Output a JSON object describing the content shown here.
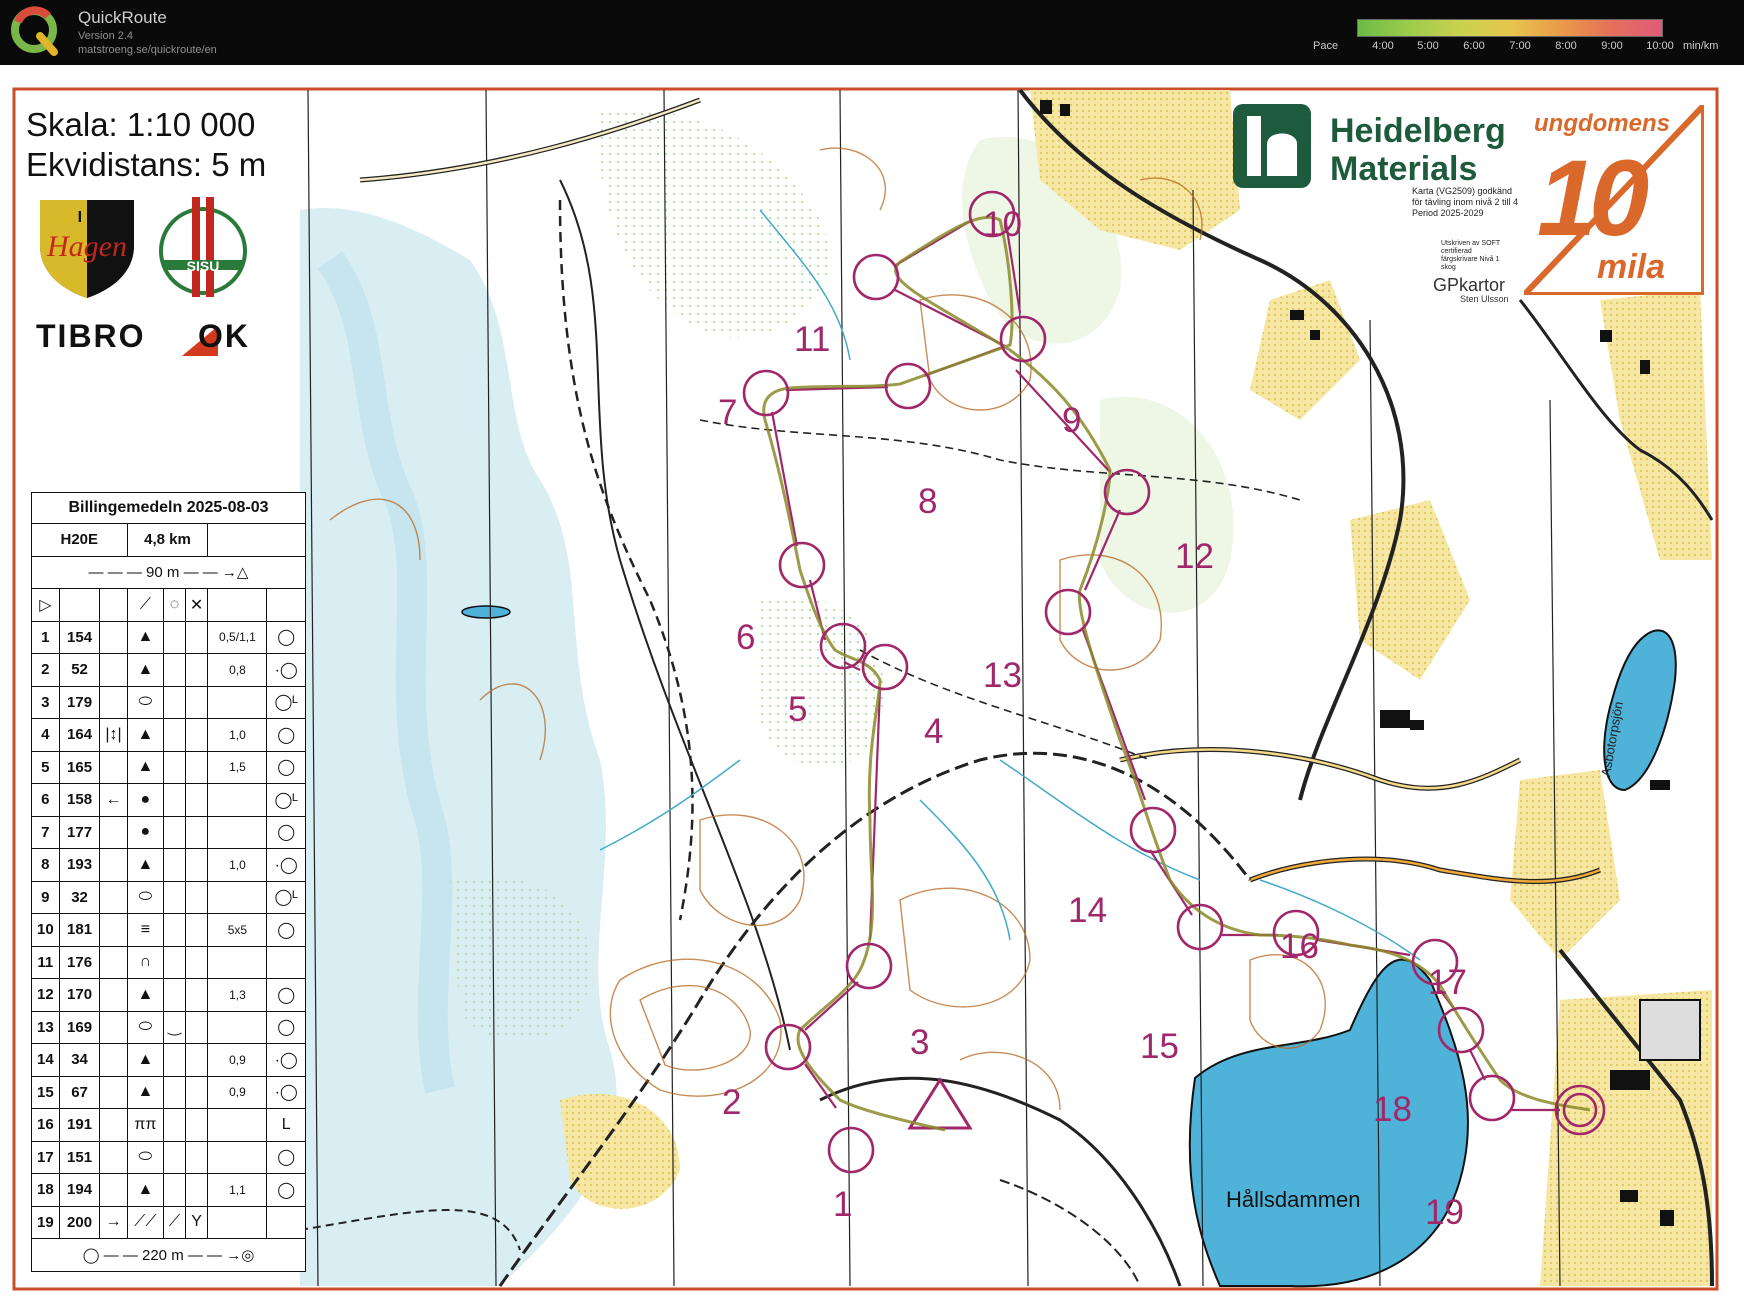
{
  "app": {
    "name": "QuickRoute",
    "version": "Version 2.4",
    "url": "matstroeng.se/quickroute/en"
  },
  "pace_scale": {
    "label": "Pace",
    "ticks": [
      "4:00",
      "5:00",
      "6:00",
      "7:00",
      "8:00",
      "9:00",
      "10:00"
    ],
    "unit": "min/km",
    "colors": [
      "#6dbb45",
      "#9ccb4c",
      "#c8d24f",
      "#e6c64d",
      "#e99a4a",
      "#e5705a",
      "#e05a7a"
    ]
  },
  "map": {
    "scale": "Skala: 1:10 000",
    "contour_interval": "Ekvidistans: 5 m",
    "club_logo_text": "I F Hagen",
    "club_logo2_text": "SISU",
    "tibro_left": "TIBRO",
    "tibro_right": "OK",
    "sponsor": "Heidelberg Materials",
    "certification": "Karta (VG2509) godkänd för tävling inom nivå 2 till 4 Period 2025-2029",
    "certification2": "Utskriven av SOFT certifierad färgskrivare Nivå 1 skog",
    "mapper": "GPkartor",
    "mapper_sub": "Sten Ulsson",
    "ten_mila_top": "ungdomens",
    "ten_mila_num": "10",
    "ten_mila_bottom": "mila",
    "lake_name": "Hållsdammen",
    "lake2_name": "Asbotorpsjön",
    "route_color": "#8a8a2a",
    "course_color": "#a0286a"
  },
  "controls": [
    {
      "n": "1"
    },
    {
      "n": "2"
    },
    {
      "n": "3"
    },
    {
      "n": "4"
    },
    {
      "n": "5"
    },
    {
      "n": "6"
    },
    {
      "n": "7"
    },
    {
      "n": "8"
    },
    {
      "n": "9"
    },
    {
      "n": "10"
    },
    {
      "n": "11"
    },
    {
      "n": "12"
    },
    {
      "n": "13"
    },
    {
      "n": "14"
    },
    {
      "n": "15"
    },
    {
      "n": "16"
    },
    {
      "n": "17"
    },
    {
      "n": "18"
    },
    {
      "n": "19"
    }
  ],
  "description": {
    "event": "Billingemedeln 2025-08-03",
    "class": "H20E",
    "length": "4,8 km",
    "start_marked": "90 m",
    "finish_marked": "220 m",
    "rows": [
      {
        "num": "1",
        "code": "154",
        "c": "",
        "d": "▲",
        "e": "",
        "f": "",
        "g": "0,5/1,1",
        "h": "◯"
      },
      {
        "num": "2",
        "code": "52",
        "c": "",
        "d": "▲",
        "e": "",
        "f": "",
        "g": "0,8",
        "h": "·◯"
      },
      {
        "num": "3",
        "code": "179",
        "c": "",
        "d": "⬭",
        "e": "",
        "f": "",
        "g": "",
        "h": "◯ᴸ"
      },
      {
        "num": "4",
        "code": "164",
        "c": "|↕|",
        "d": "▲",
        "e": "",
        "f": "",
        "g": "1,0",
        "h": "◯"
      },
      {
        "num": "5",
        "code": "165",
        "c": "",
        "d": "▲",
        "e": "",
        "f": "",
        "g": "1,5",
        "h": "◯"
      },
      {
        "num": "6",
        "code": "158",
        "c": "←",
        "d": "●",
        "e": "",
        "f": "",
        "g": "",
        "h": "◯ᴸ"
      },
      {
        "num": "7",
        "code": "177",
        "c": "",
        "d": "●",
        "e": "",
        "f": "",
        "g": "",
        "h": "◯"
      },
      {
        "num": "8",
        "code": "193",
        "c": "",
        "d": "▲",
        "e": "",
        "f": "",
        "g": "1,0",
        "h": "·◯"
      },
      {
        "num": "9",
        "code": "32",
        "c": "",
        "d": "⬭",
        "e": "",
        "f": "",
        "g": "",
        "h": "◯ᴸ"
      },
      {
        "num": "10",
        "code": "181",
        "c": "",
        "d": "≡",
        "e": "",
        "f": "",
        "g": "5x5",
        "h": "◯"
      },
      {
        "num": "11",
        "code": "176",
        "c": "",
        "d": "∩",
        "e": "",
        "f": "",
        "g": "",
        "h": ""
      },
      {
        "num": "12",
        "code": "170",
        "c": "",
        "d": "▲",
        "e": "",
        "f": "",
        "g": "1,3",
        "h": "◯"
      },
      {
        "num": "13",
        "code": "169",
        "c": "",
        "d": "⬭",
        "e": "‿",
        "f": "",
        "g": "",
        "h": "◯"
      },
      {
        "num": "14",
        "code": "34",
        "c": "",
        "d": "▲",
        "e": "",
        "f": "",
        "g": "0,9",
        "h": "·◯"
      },
      {
        "num": "15",
        "code": "67",
        "c": "",
        "d": "▲",
        "e": "",
        "f": "",
        "g": "0,9",
        "h": "·◯"
      },
      {
        "num": "16",
        "code": "191",
        "c": "",
        "d": "ππ",
        "e": "",
        "f": "",
        "g": "",
        "h": "L"
      },
      {
        "num": "17",
        "code": "151",
        "c": "",
        "d": "⬭",
        "e": "",
        "f": "",
        "g": "",
        "h": "◯"
      },
      {
        "num": "18",
        "code": "194",
        "c": "",
        "d": "▲",
        "e": "",
        "f": "",
        "g": "1,1",
        "h": "◯"
      },
      {
        "num": "19",
        "code": "200",
        "c": "→",
        "d": "⟋⟋",
        "e": "⟋",
        "f": "Y",
        "g": "",
        "h": ""
      }
    ]
  }
}
